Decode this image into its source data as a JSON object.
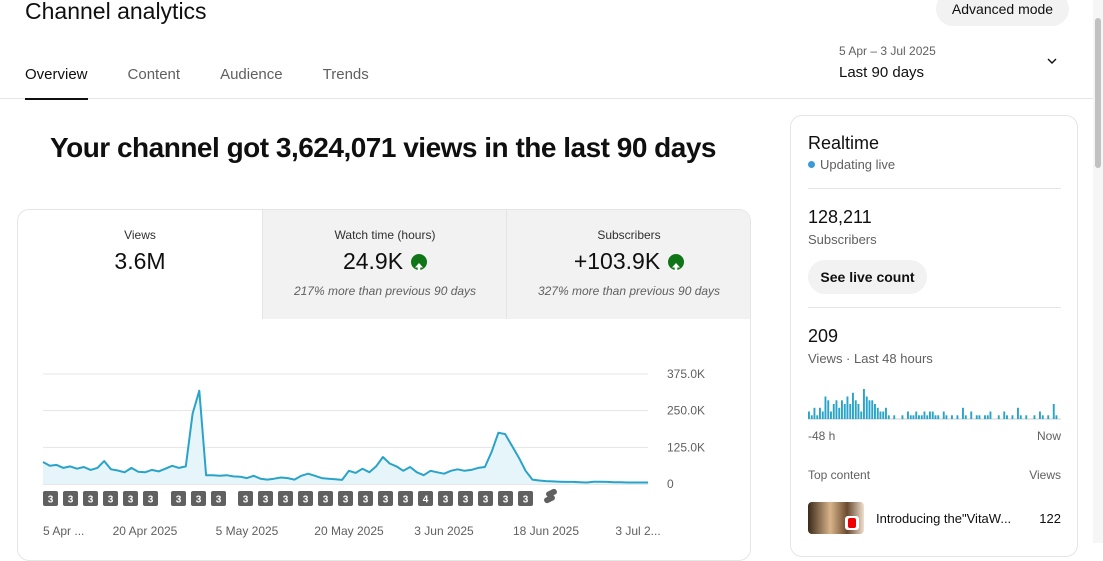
{
  "header": {
    "title": "Channel analytics",
    "advanced_mode": "Advanced mode",
    "tabs": [
      {
        "label": "Overview",
        "active": true
      },
      {
        "label": "Content"
      },
      {
        "label": "Audience"
      },
      {
        "label": "Trends"
      }
    ],
    "date_range": {
      "dates": "5 Apr – 3 Jul 2025",
      "label": "Last 90 days"
    }
  },
  "headline": "Your channel got 3,624,071 views in the last 90 days",
  "metrics": [
    {
      "label": "Views",
      "value": "3.6M",
      "note": "",
      "up": false
    },
    {
      "label": "Watch time (hours)",
      "value": "24.9K",
      "note": "217% more than previous 90 days",
      "up": true
    },
    {
      "label": "Subscribers",
      "value": "+103.9K",
      "note": "327% more than previous 90 days",
      "up": true
    }
  ],
  "chart_data": {
    "type": "area",
    "color": "#2aa3c9",
    "ylim": [
      0,
      375000
    ],
    "y_ticks": [
      "375.0K",
      "250.0K",
      "125.0K",
      "0"
    ],
    "x_ticks": [
      "5 Apr ...",
      "20 Apr 2025",
      "5 May 2025",
      "20 May 2025",
      "3 Jun 2025",
      "18 Jun 2025",
      "3 Jul 2..."
    ],
    "values": [
      75000,
      62000,
      65000,
      55000,
      60000,
      52000,
      58000,
      48000,
      55000,
      78000,
      50000,
      46000,
      40000,
      55000,
      42000,
      40000,
      48000,
      43000,
      52000,
      62000,
      55000,
      60000,
      240000,
      318000,
      30000,
      30000,
      28000,
      30000,
      26000,
      25000,
      20000,
      28000,
      18000,
      15000,
      18000,
      22000,
      20000,
      15000,
      28000,
      35000,
      28000,
      20000,
      18000,
      16000,
      14000,
      45000,
      38000,
      52000,
      40000,
      60000,
      92000,
      70000,
      60000,
      45000,
      58000,
      40000,
      30000,
      45000,
      40000,
      35000,
      45000,
      50000,
      45000,
      48000,
      55000,
      58000,
      110000,
      175000,
      170000,
      130000,
      90000,
      45000,
      15000,
      12000,
      10000,
      9000,
      8000,
      7000,
      7000,
      6000,
      5000,
      8000,
      8000,
      7000,
      6000,
      6000,
      5000,
      5000,
      5000,
      5000
    ],
    "markers": [
      "3",
      "3",
      "3",
      "3",
      "3",
      "3",
      "3",
      "3",
      "3",
      "3",
      "3",
      "3",
      "3",
      "3",
      "3",
      "3",
      "3",
      "3",
      "4",
      "3",
      "3",
      "3",
      "3",
      "3",
      "shorts"
    ]
  },
  "realtime": {
    "title": "Realtime",
    "status": "Updating live",
    "subscribers_value": "128,211",
    "subscribers_label": "Subscribers",
    "live_count_button": "See live count",
    "views_value": "209",
    "views_label": "Views · Last 48 hours",
    "bars": [
      2,
      1,
      3,
      1,
      3,
      2,
      6,
      5,
      2,
      4,
      5,
      3,
      5,
      4,
      6,
      4,
      7,
      5,
      4,
      2,
      8,
      6,
      5,
      5,
      4,
      3,
      2,
      2,
      3,
      1,
      0,
      1,
      0,
      0,
      1,
      0,
      2,
      1,
      1,
      2,
      1,
      1,
      2,
      1,
      2,
      2,
      1,
      1,
      0,
      2,
      1,
      0,
      1,
      0,
      1,
      0,
      3,
      1,
      0,
      2,
      0,
      1,
      1,
      0,
      1,
      1,
      2,
      0,
      0,
      1,
      0,
      2,
      1,
      0,
      1,
      0,
      3,
      1,
      0,
      1,
      0,
      0,
      1,
      0,
      2,
      1,
      0,
      1,
      0,
      4,
      1,
      0
    ],
    "left_label": "-48 h",
    "right_label": "Now",
    "top_content_label": "Top content",
    "views_col_label": "Views",
    "top_item_title": "Introducing the\"VitaW...",
    "top_item_views": "122"
  },
  "colors": {
    "accent": "#2aa3c9",
    "up": "#107516"
  }
}
